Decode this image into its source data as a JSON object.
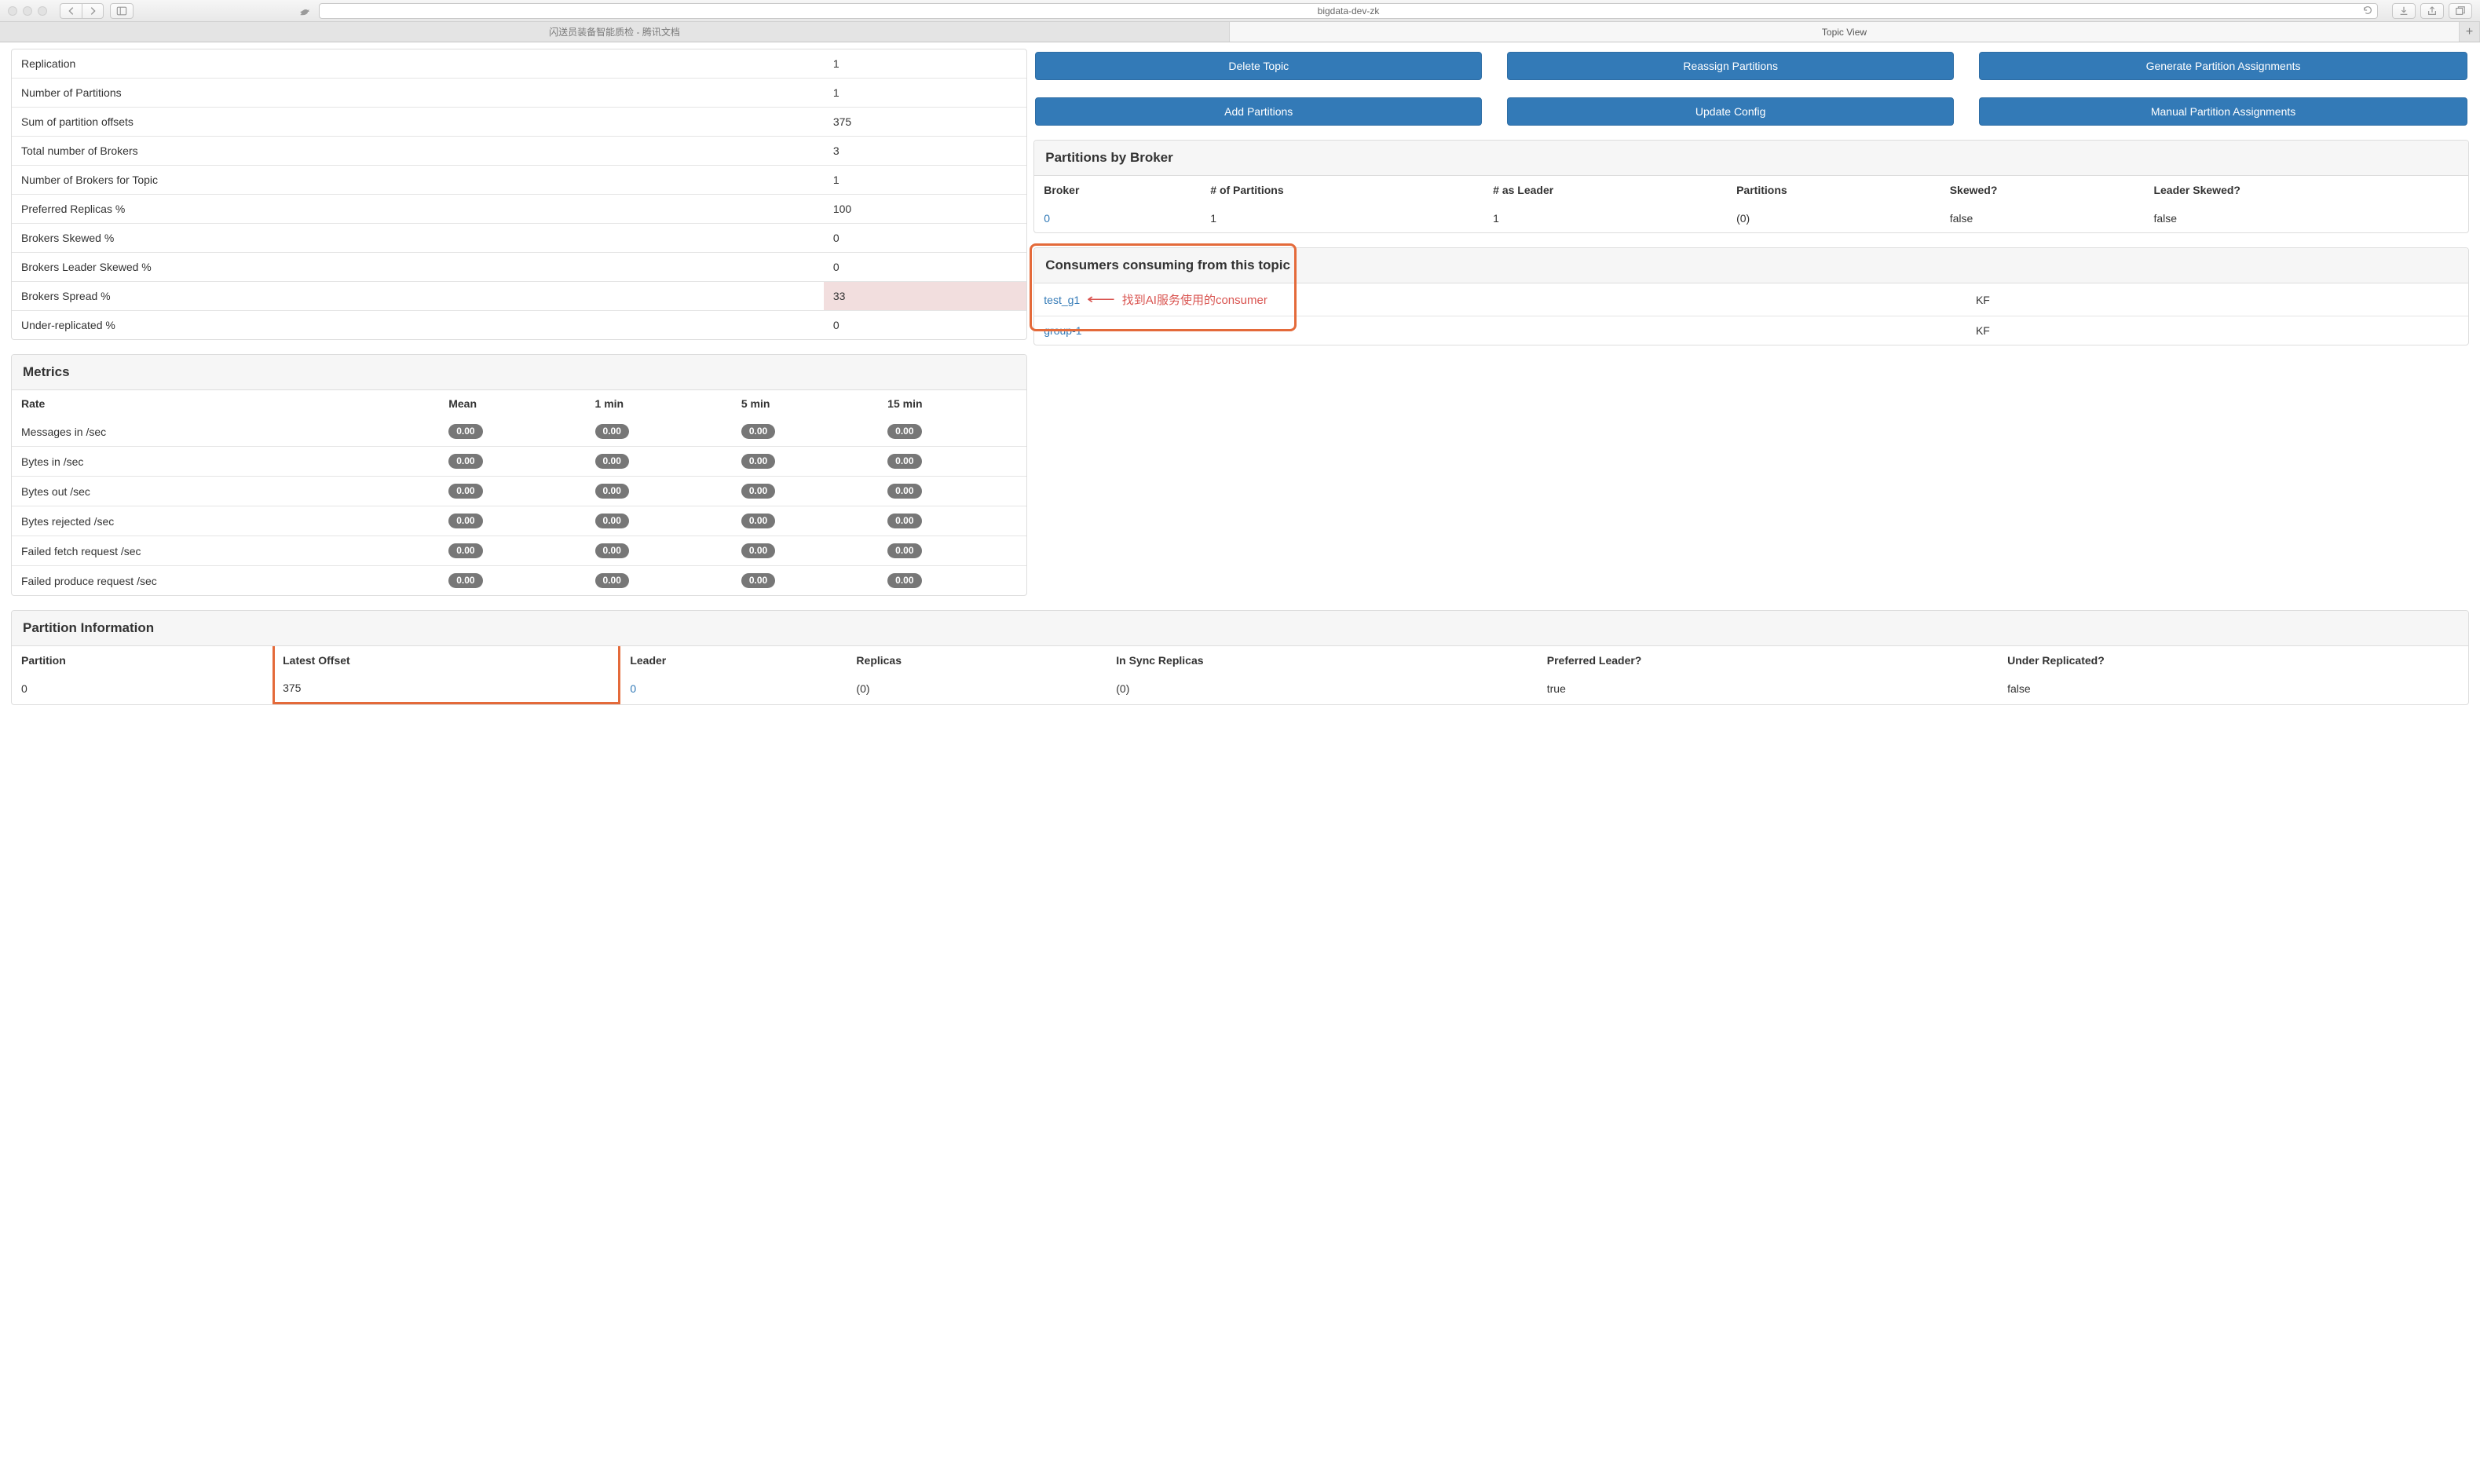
{
  "browser": {
    "address": "bigdata-dev-zk",
    "tabs": [
      {
        "title": "闪送员装备智能质检 - 腾讯文档",
        "active": false
      },
      {
        "title": "Topic View",
        "active": true
      }
    ]
  },
  "topic_stats": [
    {
      "label": "Replication",
      "value": "1"
    },
    {
      "label": "Number of Partitions",
      "value": "1"
    },
    {
      "label": "Sum of partition offsets",
      "value": "375"
    },
    {
      "label": "Total number of Brokers",
      "value": "3"
    },
    {
      "label": "Number of Brokers for Topic",
      "value": "1"
    },
    {
      "label": "Preferred Replicas %",
      "value": "100"
    },
    {
      "label": "Brokers Skewed %",
      "value": "0"
    },
    {
      "label": "Brokers Leader Skewed %",
      "value": "0"
    },
    {
      "label": "Brokers Spread %",
      "value": "33",
      "danger": true
    },
    {
      "label": "Under-replicated %",
      "value": "0"
    }
  ],
  "metrics": {
    "title": "Metrics",
    "headers": [
      "Rate",
      "Mean",
      "1 min",
      "5 min",
      "15 min"
    ],
    "rows": [
      {
        "rate": "Messages in /sec",
        "vals": [
          "0.00",
          "0.00",
          "0.00",
          "0.00"
        ]
      },
      {
        "rate": "Bytes in /sec",
        "vals": [
          "0.00",
          "0.00",
          "0.00",
          "0.00"
        ]
      },
      {
        "rate": "Bytes out /sec",
        "vals": [
          "0.00",
          "0.00",
          "0.00",
          "0.00"
        ]
      },
      {
        "rate": "Bytes rejected /sec",
        "vals": [
          "0.00",
          "0.00",
          "0.00",
          "0.00"
        ]
      },
      {
        "rate": "Failed fetch request /sec",
        "vals": [
          "0.00",
          "0.00",
          "0.00",
          "0.00"
        ]
      },
      {
        "rate": "Failed produce request /sec",
        "vals": [
          "0.00",
          "0.00",
          "0.00",
          "0.00"
        ]
      }
    ]
  },
  "operations": {
    "delete_topic": "Delete Topic",
    "reassign_partitions": "Reassign Partitions",
    "generate_assignments": "Generate Partition Assignments",
    "add_partitions": "Add Partitions",
    "update_config": "Update Config",
    "manual_assignments": "Manual Partition Assignments"
  },
  "partitions_by_broker": {
    "title": "Partitions by Broker",
    "headers": [
      "Broker",
      "# of Partitions",
      "# as Leader",
      "Partitions",
      "Skewed?",
      "Leader Skewed?"
    ],
    "rows": [
      {
        "broker": "0",
        "numPartitions": "1",
        "asLeader": "1",
        "partitions": "(0)",
        "skewed": "false",
        "leaderSkewed": "false"
      }
    ]
  },
  "consumers": {
    "title": "Consumers consuming from this topic",
    "rows": [
      {
        "name": "test_g1",
        "type": "KF"
      },
      {
        "name": "group-1",
        "type": "KF"
      }
    ],
    "annotation": "找到AI服务使用的consumer"
  },
  "partition_info": {
    "title": "Partition Information",
    "headers": [
      "Partition",
      "Latest Offset",
      "Leader",
      "Replicas",
      "In Sync Replicas",
      "Preferred Leader?",
      "Under Replicated?"
    ],
    "rows": [
      {
        "partition": "0",
        "latestOffset": "375",
        "leader": "0",
        "replicas": "(0)",
        "isr": "(0)",
        "preferred": "true",
        "under": "false"
      }
    ]
  }
}
